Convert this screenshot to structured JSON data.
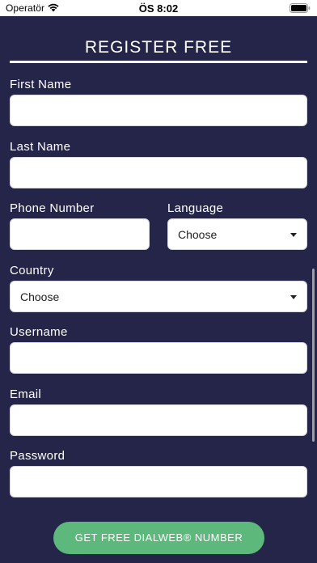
{
  "status_bar": {
    "carrier": "Operatör",
    "time": "ÖS 8:02"
  },
  "form": {
    "title": "REGISTER FREE",
    "first_name": {
      "label": "First Name",
      "value": ""
    },
    "last_name": {
      "label": "Last Name",
      "value": ""
    },
    "phone_number": {
      "label": "Phone Number",
      "value": ""
    },
    "language": {
      "label": "Language",
      "selected": "Choose"
    },
    "country": {
      "label": "Country",
      "selected": "Choose"
    },
    "username": {
      "label": "Username",
      "value": ""
    },
    "email": {
      "label": "Email",
      "value": ""
    },
    "password": {
      "label": "Password",
      "value": ""
    },
    "submit_label": "GET FREE DIALWEB® NUMBER"
  },
  "colors": {
    "background": "#252449",
    "field": "#ffffff",
    "button": "#5cb97b",
    "text": "#ffffff"
  },
  "icons": [
    "wifi-icon",
    "battery-icon",
    "dropdown-caret-icon"
  ]
}
